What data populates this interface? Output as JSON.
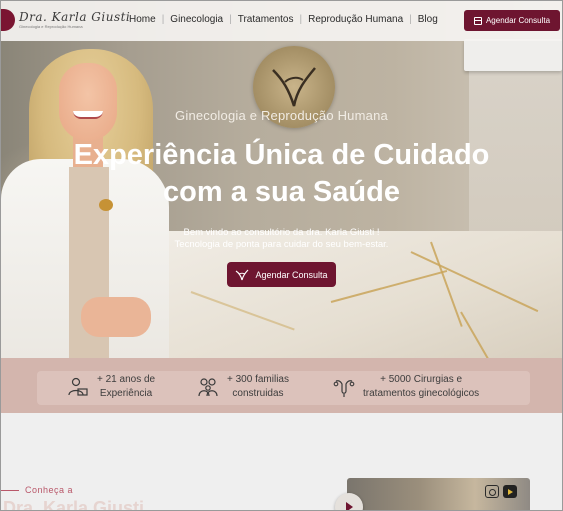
{
  "header": {
    "logo": {
      "name": "Dra. Karla Giusti",
      "subtitle": "Ginecologia e Reprodução Humana"
    },
    "nav": [
      {
        "label": "Home"
      },
      {
        "label": "Ginecologia"
      },
      {
        "label": "Tratamentos"
      },
      {
        "label": "Reprodução Humana"
      },
      {
        "label": "Blog"
      }
    ],
    "cta_label": "Agendar Consulta"
  },
  "hero": {
    "subtitle": "Ginecologia e Reprodução Humana",
    "title_line1": "Experiência Única de Cuidado",
    "title_line2": "com a sua Saúde",
    "desc_line1": "Bem vindo ao consultório da dra. Karla Giusti !",
    "desc_line2": "Tecnologia de ponta para cuidar do seu bem-estar.",
    "cta_label": "Agendar Consulta"
  },
  "stats": [
    {
      "icon": "doctor-laptop-icon",
      "line1": "+ 21 anos de",
      "line2": "Experiência"
    },
    {
      "icon": "family-icon",
      "line1": "+ 300 familias",
      "line2": "construidas"
    },
    {
      "icon": "uterus-icon",
      "line1": "+ 5000 Cirurgias  e",
      "line2": "tratamentos ginecológicos"
    }
  ],
  "about": {
    "label": "Conheça a",
    "name": "Dra. Karla Giusti"
  },
  "social": [
    "instagram-icon",
    "youtube-icon"
  ],
  "colors": {
    "brand": "#6e1530",
    "band": "#d3b5ad",
    "accent_text": "#b9586a"
  }
}
